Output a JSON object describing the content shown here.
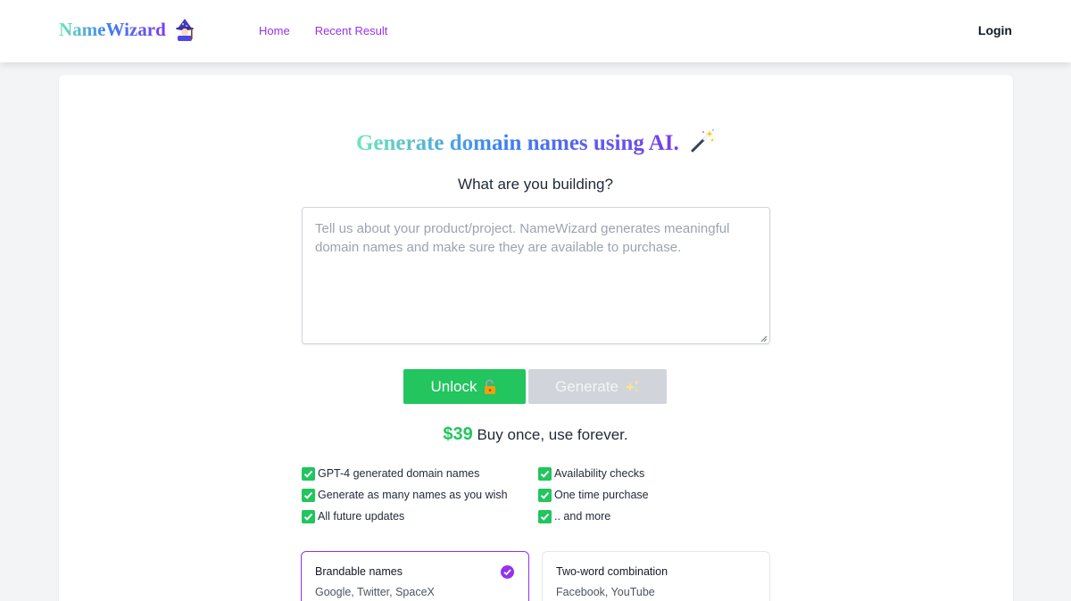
{
  "header": {
    "logo_text": "NameWizard",
    "logo_icon": "wizard-icon",
    "nav": [
      {
        "label": "Home"
      },
      {
        "label": "Recent Result"
      }
    ],
    "login_label": "Login"
  },
  "hero": {
    "title": "Generate domain names using AI.",
    "title_icon": "magic-wand-icon",
    "subtitle": "What are you building?"
  },
  "description_input": {
    "value": "",
    "placeholder": "Tell us about your product/project. NameWizard generates meaningful domain names and make sure they are available to purchase."
  },
  "actions": {
    "unlock_label": "Unlock",
    "unlock_icon": "unlocked-padlock-icon",
    "generate_label": "Generate",
    "generate_icon": "sparkles-icon"
  },
  "pricing": {
    "amount": "$39",
    "tagline": "Buy once, use forever."
  },
  "features": [
    {
      "label": "GPT-4 generated domain names"
    },
    {
      "label": "Availability checks"
    },
    {
      "label": "Generate as many names as you wish"
    },
    {
      "label": "One time purchase"
    },
    {
      "label": "All future updates"
    },
    {
      "label": ".. and more"
    }
  ],
  "name_styles": [
    {
      "title": "Brandable names",
      "examples": "Google, Twitter, SpaceX",
      "selected": true
    },
    {
      "title": "Two-word combination",
      "examples": "Facebook, YouTube",
      "selected": false
    }
  ],
  "colors": {
    "accent_purple": "#9333ea",
    "success_green": "#22c55e",
    "disabled_gray": "#d1d5db",
    "page_background": "#f3f4f6"
  }
}
